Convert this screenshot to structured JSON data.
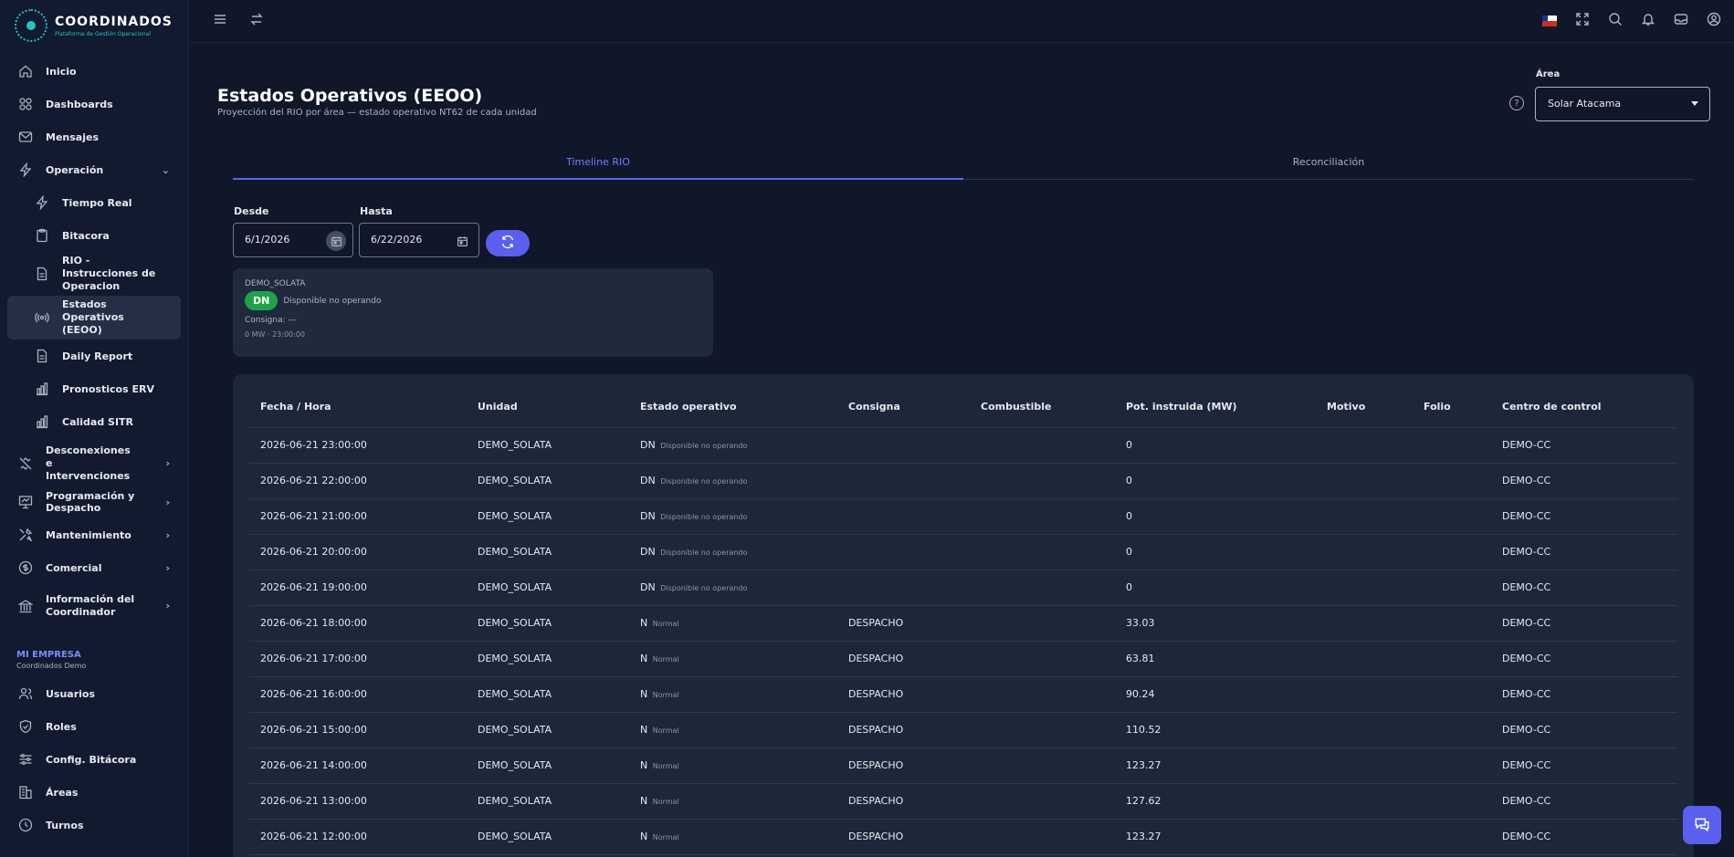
{
  "brand": {
    "title": "COORDINADOS",
    "subtitle": "Plataforma de Gestión Operacional"
  },
  "sidebar": {
    "items": [
      {
        "label": "Inicio",
        "icon": "home-icon"
      },
      {
        "label": "Dashboards",
        "icon": "grid-icon"
      },
      {
        "label": "Mensajes",
        "icon": "mail-icon"
      },
      {
        "label": "Operación",
        "icon": "bolt-icon"
      },
      {
        "label": "Tiempo Real",
        "icon": "bolt-icon"
      },
      {
        "label": "Bitacora",
        "icon": "clipboard-icon"
      },
      {
        "label": "RIO - Instrucciones de Operacion",
        "icon": "document-icon"
      },
      {
        "label": "Estados Operativos (EEOO)",
        "icon": "broadcast-icon"
      },
      {
        "label": "Daily Report",
        "icon": "document-icon"
      },
      {
        "label": "Pronosticos ERV",
        "icon": "bar-chart-icon"
      },
      {
        "label": "Calidad SITR",
        "icon": "bar-chart-icon"
      },
      {
        "label": "Desconexiones e Intervenciones",
        "icon": "unplug-icon"
      },
      {
        "label": "Programación y Despacho",
        "icon": "presentation-icon"
      },
      {
        "label": "Mantenimiento",
        "icon": "tools-icon"
      },
      {
        "label": "Comercial",
        "icon": "dollar-icon"
      },
      {
        "label": "Información del Coordinador",
        "icon": "bank-icon"
      }
    ],
    "section_label": "MI EMPRESA",
    "section_sub": "Coordinados Demo",
    "company_items": [
      {
        "label": "Usuarios",
        "icon": "users-icon"
      },
      {
        "label": "Roles",
        "icon": "shield-icon"
      },
      {
        "label": "Config. Bitácora",
        "icon": "sliders-icon"
      },
      {
        "label": "Áreas",
        "icon": "building-icon"
      },
      {
        "label": "Turnos",
        "icon": "clock-icon"
      }
    ]
  },
  "header": {
    "title": "Estados Operativos (EEOO)",
    "subtitle": "Proyección del RIO por área — estado operativo NT62 de cada unidad",
    "area_label": "Área",
    "area_value": "Solar Atacama"
  },
  "tabs": [
    {
      "label": "Timeline RIO"
    },
    {
      "label": "Reconciliación"
    }
  ],
  "filters": {
    "desde_label": "Desde",
    "desde_value": "6/1/2026",
    "hasta_label": "Hasta",
    "hasta_value": "6/22/2026"
  },
  "unit_card": {
    "name": "DEMO_SOLATA",
    "chip": "DN",
    "desc": "Disponible no operando",
    "consigna": "Consigna: —",
    "mw": "0 MW · 23:00:00"
  },
  "table": {
    "columns": [
      "Fecha / Hora",
      "Unidad",
      "Estado operativo",
      "Consigna",
      "Combustible",
      "Pot. instruida (MW)",
      "Motivo",
      "Folio",
      "Centro de control"
    ],
    "rows": [
      {
        "fecha": "2026-06-21 23:00:00",
        "unidad": "DEMO_SOLATA",
        "code": "DN",
        "estado": "Disponible no operando",
        "consigna": "",
        "combustible": "",
        "pot": "0",
        "motivo": "",
        "folio": "",
        "centro": "DEMO-CC"
      },
      {
        "fecha": "2026-06-21 22:00:00",
        "unidad": "DEMO_SOLATA",
        "code": "DN",
        "estado": "Disponible no operando",
        "consigna": "",
        "combustible": "",
        "pot": "0",
        "motivo": "",
        "folio": "",
        "centro": "DEMO-CC"
      },
      {
        "fecha": "2026-06-21 21:00:00",
        "unidad": "DEMO_SOLATA",
        "code": "DN",
        "estado": "Disponible no operando",
        "consigna": "",
        "combustible": "",
        "pot": "0",
        "motivo": "",
        "folio": "",
        "centro": "DEMO-CC"
      },
      {
        "fecha": "2026-06-21 20:00:00",
        "unidad": "DEMO_SOLATA",
        "code": "DN",
        "estado": "Disponible no operando",
        "consigna": "",
        "combustible": "",
        "pot": "0",
        "motivo": "",
        "folio": "",
        "centro": "DEMO-CC"
      },
      {
        "fecha": "2026-06-21 19:00:00",
        "unidad": "DEMO_SOLATA",
        "code": "DN",
        "estado": "Disponible no operando",
        "consigna": "",
        "combustible": "",
        "pot": "0",
        "motivo": "",
        "folio": "",
        "centro": "DEMO-CC"
      },
      {
        "fecha": "2026-06-21 18:00:00",
        "unidad": "DEMO_SOLATA",
        "code": "N",
        "estado": "Normal",
        "consigna": "DESPACHO",
        "combustible": "",
        "pot": "33.03",
        "motivo": "",
        "folio": "",
        "centro": "DEMO-CC"
      },
      {
        "fecha": "2026-06-21 17:00:00",
        "unidad": "DEMO_SOLATA",
        "code": "N",
        "estado": "Normal",
        "consigna": "DESPACHO",
        "combustible": "",
        "pot": "63.81",
        "motivo": "",
        "folio": "",
        "centro": "DEMO-CC"
      },
      {
        "fecha": "2026-06-21 16:00:00",
        "unidad": "DEMO_SOLATA",
        "code": "N",
        "estado": "Normal",
        "consigna": "DESPACHO",
        "combustible": "",
        "pot": "90.24",
        "motivo": "",
        "folio": "",
        "centro": "DEMO-CC"
      },
      {
        "fecha": "2026-06-21 15:00:00",
        "unidad": "DEMO_SOLATA",
        "code": "N",
        "estado": "Normal",
        "consigna": "DESPACHO",
        "combustible": "",
        "pot": "110.52",
        "motivo": "",
        "folio": "",
        "centro": "DEMO-CC"
      },
      {
        "fecha": "2026-06-21 14:00:00",
        "unidad": "DEMO_SOLATA",
        "code": "N",
        "estado": "Normal",
        "consigna": "DESPACHO",
        "combustible": "",
        "pot": "123.27",
        "motivo": "",
        "folio": "",
        "centro": "DEMO-CC"
      },
      {
        "fecha": "2026-06-21 13:00:00",
        "unidad": "DEMO_SOLATA",
        "code": "N",
        "estado": "Normal",
        "consigna": "DESPACHO",
        "combustible": "",
        "pot": "127.62",
        "motivo": "",
        "folio": "",
        "centro": "DEMO-CC"
      },
      {
        "fecha": "2026-06-21 12:00:00",
        "unidad": "DEMO_SOLATA",
        "code": "N",
        "estado": "Normal",
        "consigna": "DESPACHO",
        "combustible": "",
        "pot": "123.27",
        "motivo": "",
        "folio": "",
        "centro": "DEMO-CC"
      }
    ]
  },
  "topbar_icons": [
    "menu-icon",
    "swap-icon",
    "flag-icon",
    "fullscreen-icon",
    "search-icon",
    "bell-icon",
    "inbox-icon",
    "user-icon"
  ],
  "colors": {
    "accent": "#5b5ff0",
    "available": "#1fa34a",
    "background": "#0f1729"
  }
}
